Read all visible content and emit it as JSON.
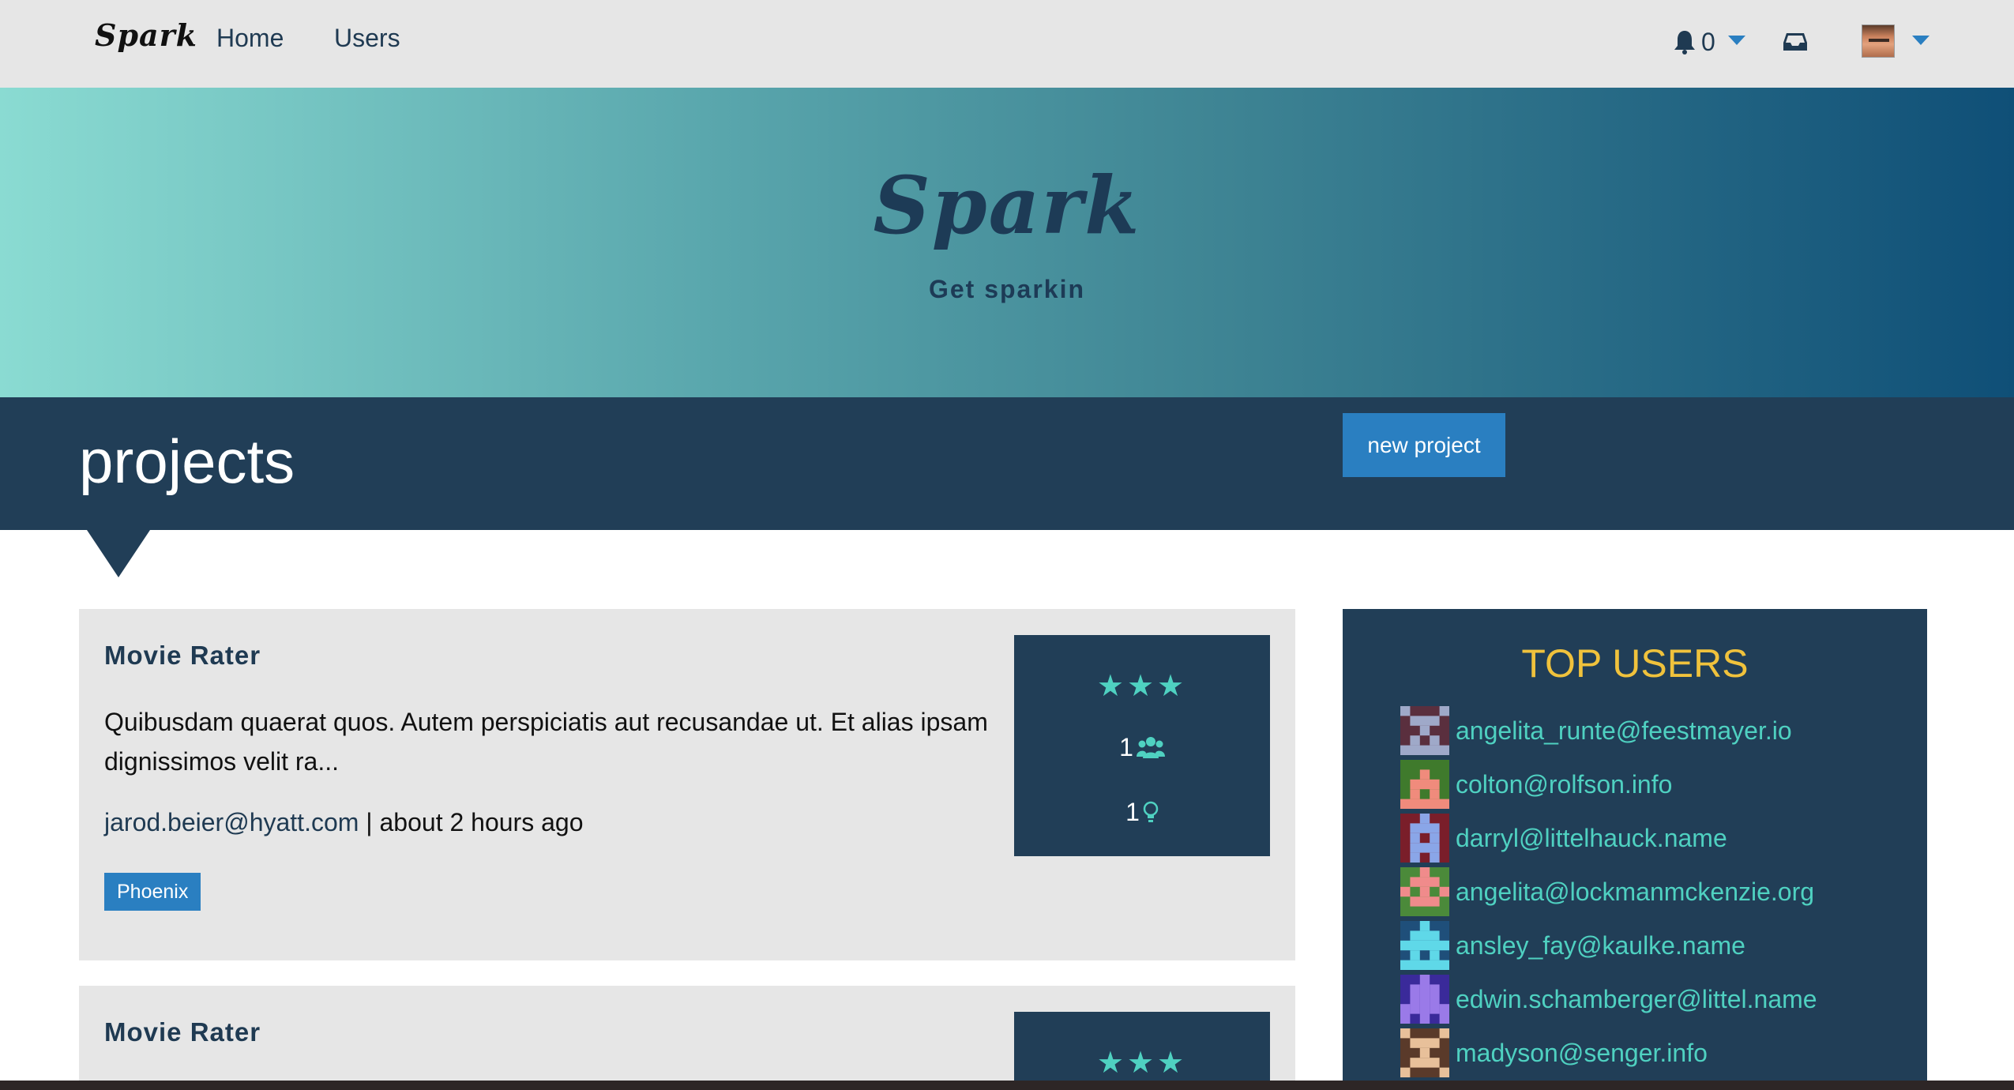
{
  "nav": {
    "brand": "Spark",
    "home": "Home",
    "users": "Users",
    "notification_count": "0"
  },
  "hero": {
    "title": "Spark",
    "tagline": "Get sparkin"
  },
  "section": {
    "title": "projects",
    "new_project_label": "new project"
  },
  "projects": [
    {
      "title": "Movie Rater",
      "description": "Quibusdam quaerat quos. Autem perspiciatis aut recusandae ut. Et alias ipsam dignissimos velit ra...",
      "author": "jarod.beier@hyatt.com",
      "meta_sep": " | ",
      "time": "about 2 hours ago",
      "tag": "Phoenix",
      "rating_stars": 3,
      "members": "1",
      "ideas": "1"
    },
    {
      "title": "Movie Rater",
      "rating_stars": 3
    }
  ],
  "top_users": {
    "title": "TOP USERS",
    "users": [
      {
        "email": "angelita_runte@feestmayer.io",
        "bg": "#5a2f3e",
        "fg": "#9fa9c9"
      },
      {
        "email": "colton@rolfson.info",
        "bg": "#3f7a2c",
        "fg": "#f08b7c"
      },
      {
        "email": "darryl@littelhauck.name",
        "bg": "#7a1e2a",
        "fg": "#8aa6e8"
      },
      {
        "email": "angelita@lockmanmckenzie.org",
        "bg": "#4b8a3a",
        "fg": "#f08b8b"
      },
      {
        "email": "ansley_fay@kaulke.name",
        "bg": "#1f4f7a",
        "fg": "#5fd8e8"
      },
      {
        "email": "edwin.schamberger@littel.name",
        "bg": "#3a2a9a",
        "fg": "#9a7ae8"
      },
      {
        "email": "madyson@senger.info",
        "bg": "#5a3a2a",
        "fg": "#e8c09a"
      }
    ]
  },
  "colors": {
    "accent": "#2a7fc1",
    "dark_panel": "#213e57",
    "teal": "#4fd1c1",
    "gold": "#f0c23c"
  }
}
